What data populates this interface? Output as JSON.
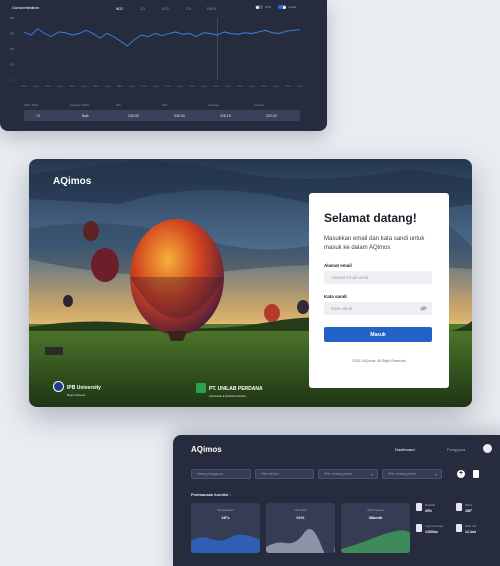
{
  "top_dashboard": {
    "title": "Concentration",
    "tabs": [
      "NO2",
      "CO",
      "SO2",
      "O3",
      "PM10"
    ],
    "active_tab": 0,
    "toggle1_label": "NO2",
    "toggle2_label": "Grafik",
    "y_ticks": [
      "400",
      "300",
      "200",
      "100",
      "0"
    ],
    "x_ticks": [
      "00:00",
      "01:00",
      "02:00",
      "03:00",
      "04:00",
      "05:00",
      "06:00",
      "07:00",
      "08:00",
      "09:00",
      "10:00",
      "11:00",
      "12:00",
      "13:00",
      "14:00",
      "15:00",
      "16:00",
      "17:00",
      "18:00",
      "19:00",
      "20:00",
      "21:00",
      "22:00",
      "23:00"
    ],
    "columns": [
      "ISPU NO2",
      "Kategori ISPU",
      "Min",
      "Max",
      "Average",
      "Current"
    ],
    "values": [
      "74",
      "Baik",
      "234.00",
      "339.00",
      "315.18",
      "322.00"
    ],
    "chart_data": {
      "type": "line",
      "values": [
        310,
        290,
        330,
        300,
        280,
        310,
        305,
        290,
        300,
        320,
        300,
        270,
        300,
        280,
        250,
        220,
        260,
        290,
        280,
        300,
        285,
        300,
        310,
        295,
        300,
        280,
        305,
        300,
        290,
        310,
        300,
        295,
        305,
        300,
        310,
        320,
        305,
        300,
        315,
        320,
        325
      ],
      "ylim": [
        0,
        400
      ],
      "line_color": "#3a86e8"
    }
  },
  "login": {
    "brand": "AQimos",
    "title": "Selamat datang!",
    "subtitle": "Masukkan email dan kata sandi untuk masuk ke dalam AQimos",
    "email_label": "Alamat email",
    "email_placeholder": "Alamat email anda",
    "password_label": "Kata sandi",
    "password_placeholder": "Kata sandi",
    "submit_label": "Masuk",
    "copyright": "©2021 AQimos. All Right Reserved",
    "partner1_name": "IPB University",
    "partner1_sub": "Bogor Indonesia",
    "partner2_name": "PT. UNILAB PERDANA",
    "partner2_sub": "Instruments & Technical Services",
    "primary_color": "#2363c8"
  },
  "bottom_dashboard": {
    "brand": "AQimos",
    "nav_dashboard": "Dashboard",
    "nav_users": "Pengguna",
    "filter1": "Nama pengguna",
    "filter2": "Pilih device",
    "filter3": "Pilih rentang awal",
    "filter4": "Pilih rentang akhir",
    "section_title": "Pembacaan kondisi :",
    "cards": [
      {
        "label": "Temperature",
        "value": "28°c"
      },
      {
        "label": "Humidity",
        "value": "61%"
      },
      {
        "label": "Wind Speed",
        "value": "36km/h"
      }
    ],
    "stats": [
      {
        "label": "Rainfall",
        "value": "20%"
      },
      {
        "label": "Wind",
        "value": "180°"
      },
      {
        "label": "Light Intensity",
        "value": "1200lux"
      },
      {
        "label": "Rain Vol",
        "value": "12.4ml"
      }
    ]
  }
}
